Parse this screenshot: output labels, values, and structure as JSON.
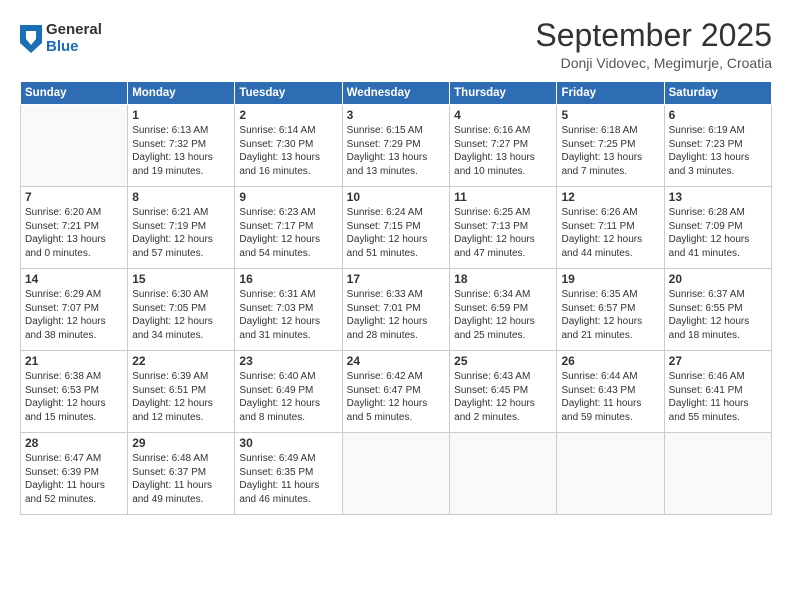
{
  "logo": {
    "general": "General",
    "blue": "Blue"
  },
  "title": "September 2025",
  "location": "Donji Vidovec, Megimurje, Croatia",
  "days_of_week": [
    "Sunday",
    "Monday",
    "Tuesday",
    "Wednesday",
    "Thursday",
    "Friday",
    "Saturday"
  ],
  "weeks": [
    [
      {
        "day": "",
        "info": ""
      },
      {
        "day": "1",
        "info": "Sunrise: 6:13 AM\nSunset: 7:32 PM\nDaylight: 13 hours\nand 19 minutes."
      },
      {
        "day": "2",
        "info": "Sunrise: 6:14 AM\nSunset: 7:30 PM\nDaylight: 13 hours\nand 16 minutes."
      },
      {
        "day": "3",
        "info": "Sunrise: 6:15 AM\nSunset: 7:29 PM\nDaylight: 13 hours\nand 13 minutes."
      },
      {
        "day": "4",
        "info": "Sunrise: 6:16 AM\nSunset: 7:27 PM\nDaylight: 13 hours\nand 10 minutes."
      },
      {
        "day": "5",
        "info": "Sunrise: 6:18 AM\nSunset: 7:25 PM\nDaylight: 13 hours\nand 7 minutes."
      },
      {
        "day": "6",
        "info": "Sunrise: 6:19 AM\nSunset: 7:23 PM\nDaylight: 13 hours\nand 3 minutes."
      }
    ],
    [
      {
        "day": "7",
        "info": "Sunrise: 6:20 AM\nSunset: 7:21 PM\nDaylight: 13 hours\nand 0 minutes."
      },
      {
        "day": "8",
        "info": "Sunrise: 6:21 AM\nSunset: 7:19 PM\nDaylight: 12 hours\nand 57 minutes."
      },
      {
        "day": "9",
        "info": "Sunrise: 6:23 AM\nSunset: 7:17 PM\nDaylight: 12 hours\nand 54 minutes."
      },
      {
        "day": "10",
        "info": "Sunrise: 6:24 AM\nSunset: 7:15 PM\nDaylight: 12 hours\nand 51 minutes."
      },
      {
        "day": "11",
        "info": "Sunrise: 6:25 AM\nSunset: 7:13 PM\nDaylight: 12 hours\nand 47 minutes."
      },
      {
        "day": "12",
        "info": "Sunrise: 6:26 AM\nSunset: 7:11 PM\nDaylight: 12 hours\nand 44 minutes."
      },
      {
        "day": "13",
        "info": "Sunrise: 6:28 AM\nSunset: 7:09 PM\nDaylight: 12 hours\nand 41 minutes."
      }
    ],
    [
      {
        "day": "14",
        "info": "Sunrise: 6:29 AM\nSunset: 7:07 PM\nDaylight: 12 hours\nand 38 minutes."
      },
      {
        "day": "15",
        "info": "Sunrise: 6:30 AM\nSunset: 7:05 PM\nDaylight: 12 hours\nand 34 minutes."
      },
      {
        "day": "16",
        "info": "Sunrise: 6:31 AM\nSunset: 7:03 PM\nDaylight: 12 hours\nand 31 minutes."
      },
      {
        "day": "17",
        "info": "Sunrise: 6:33 AM\nSunset: 7:01 PM\nDaylight: 12 hours\nand 28 minutes."
      },
      {
        "day": "18",
        "info": "Sunrise: 6:34 AM\nSunset: 6:59 PM\nDaylight: 12 hours\nand 25 minutes."
      },
      {
        "day": "19",
        "info": "Sunrise: 6:35 AM\nSunset: 6:57 PM\nDaylight: 12 hours\nand 21 minutes."
      },
      {
        "day": "20",
        "info": "Sunrise: 6:37 AM\nSunset: 6:55 PM\nDaylight: 12 hours\nand 18 minutes."
      }
    ],
    [
      {
        "day": "21",
        "info": "Sunrise: 6:38 AM\nSunset: 6:53 PM\nDaylight: 12 hours\nand 15 minutes."
      },
      {
        "day": "22",
        "info": "Sunrise: 6:39 AM\nSunset: 6:51 PM\nDaylight: 12 hours\nand 12 minutes."
      },
      {
        "day": "23",
        "info": "Sunrise: 6:40 AM\nSunset: 6:49 PM\nDaylight: 12 hours\nand 8 minutes."
      },
      {
        "day": "24",
        "info": "Sunrise: 6:42 AM\nSunset: 6:47 PM\nDaylight: 12 hours\nand 5 minutes."
      },
      {
        "day": "25",
        "info": "Sunrise: 6:43 AM\nSunset: 6:45 PM\nDaylight: 12 hours\nand 2 minutes."
      },
      {
        "day": "26",
        "info": "Sunrise: 6:44 AM\nSunset: 6:43 PM\nDaylight: 11 hours\nand 59 minutes."
      },
      {
        "day": "27",
        "info": "Sunrise: 6:46 AM\nSunset: 6:41 PM\nDaylight: 11 hours\nand 55 minutes."
      }
    ],
    [
      {
        "day": "28",
        "info": "Sunrise: 6:47 AM\nSunset: 6:39 PM\nDaylight: 11 hours\nand 52 minutes."
      },
      {
        "day": "29",
        "info": "Sunrise: 6:48 AM\nSunset: 6:37 PM\nDaylight: 11 hours\nand 49 minutes."
      },
      {
        "day": "30",
        "info": "Sunrise: 6:49 AM\nSunset: 6:35 PM\nDaylight: 11 hours\nand 46 minutes."
      },
      {
        "day": "",
        "info": ""
      },
      {
        "day": "",
        "info": ""
      },
      {
        "day": "",
        "info": ""
      },
      {
        "day": "",
        "info": ""
      }
    ]
  ]
}
